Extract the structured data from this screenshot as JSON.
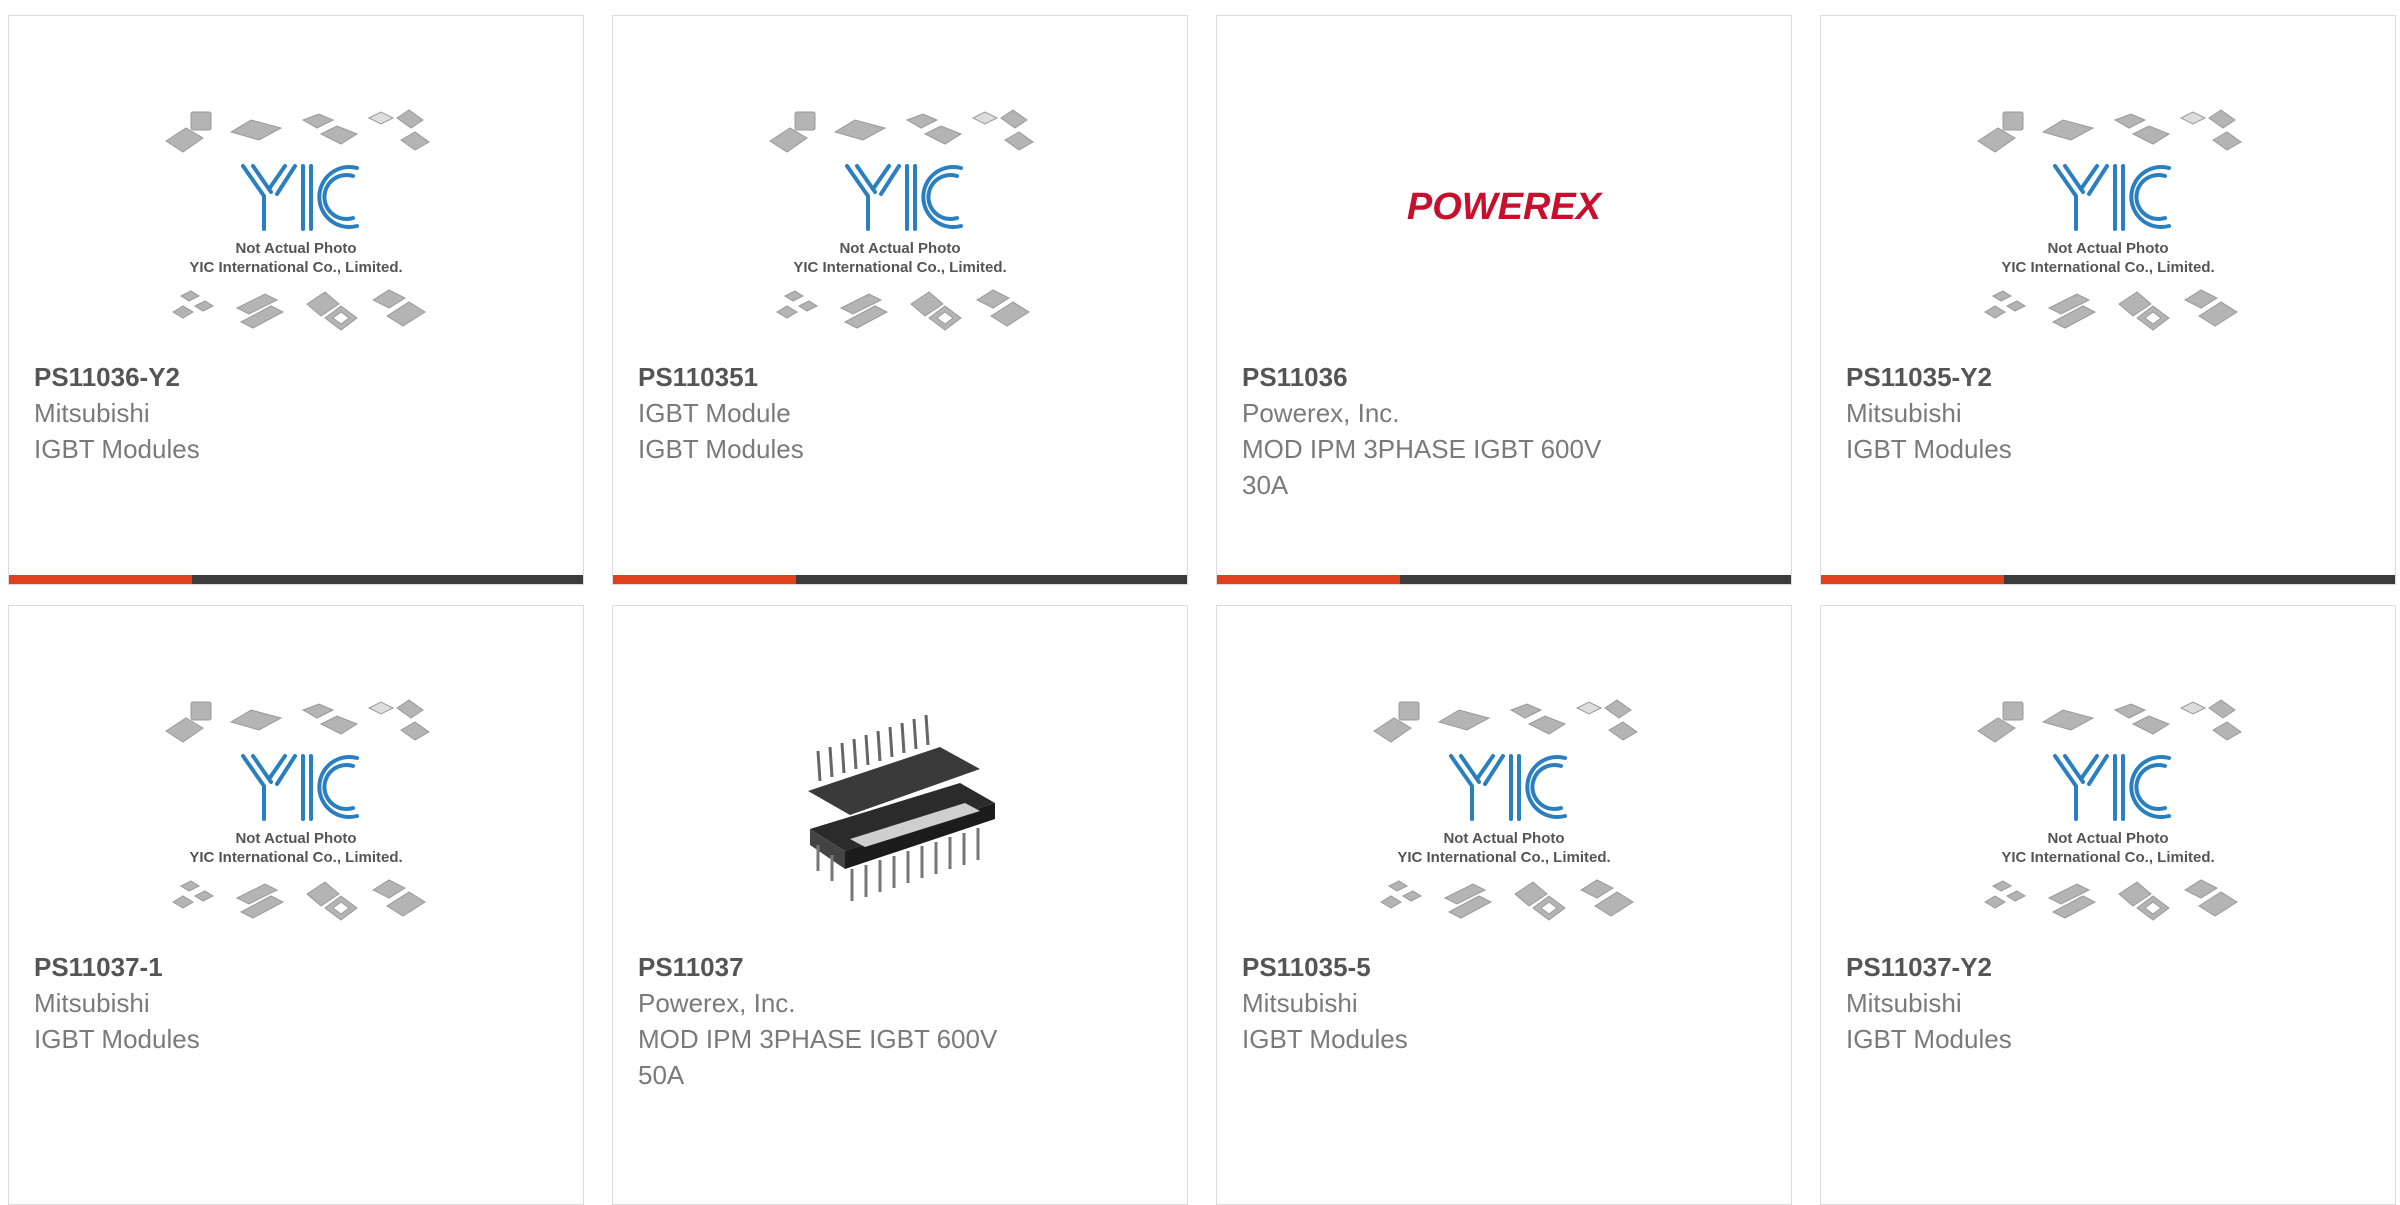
{
  "placeholder": {
    "brand": "YIC",
    "line1": "Not Actual Photo",
    "line2": "YIC International Co., Limited."
  },
  "powerex_logo": "POWEREX",
  "colors": {
    "accent": "#e0401d",
    "bar": "#3b3b3b",
    "yic_blue": "#2a7fc0",
    "powerex_red": "#c8102e"
  },
  "products": [
    {
      "part": "PS11036-Y2",
      "line1": "Mitsubishi",
      "line2": "IGBT Modules",
      "line3": "",
      "image": "yic-placeholder"
    },
    {
      "part": "PS110351",
      "line1": "IGBT Module",
      "line2": "IGBT Modules",
      "line3": "",
      "image": "yic-placeholder"
    },
    {
      "part": "PS11036",
      "line1": "Powerex, Inc.",
      "line2": "MOD IPM 3PHASE IGBT 600V",
      "line3": "30A",
      "image": "powerex-logo"
    },
    {
      "part": "PS11035-Y2",
      "line1": "Mitsubishi",
      "line2": "IGBT Modules",
      "line3": "",
      "image": "yic-placeholder"
    },
    {
      "part": "PS11037-1",
      "line1": "Mitsubishi",
      "line2": "IGBT Modules",
      "line3": "",
      "image": "yic-placeholder"
    },
    {
      "part": "PS11037",
      "line1": "Powerex, Inc.",
      "line2": "MOD IPM 3PHASE IGBT 600V",
      "line3": "50A",
      "image": "ipm-module-photo"
    },
    {
      "part": "PS11035-5",
      "line1": "Mitsubishi",
      "line2": "IGBT Modules",
      "line3": "",
      "image": "yic-placeholder"
    },
    {
      "part": "PS11037-Y2",
      "line1": "Mitsubishi",
      "line2": "IGBT Modules",
      "line3": "",
      "image": "yic-placeholder"
    }
  ]
}
